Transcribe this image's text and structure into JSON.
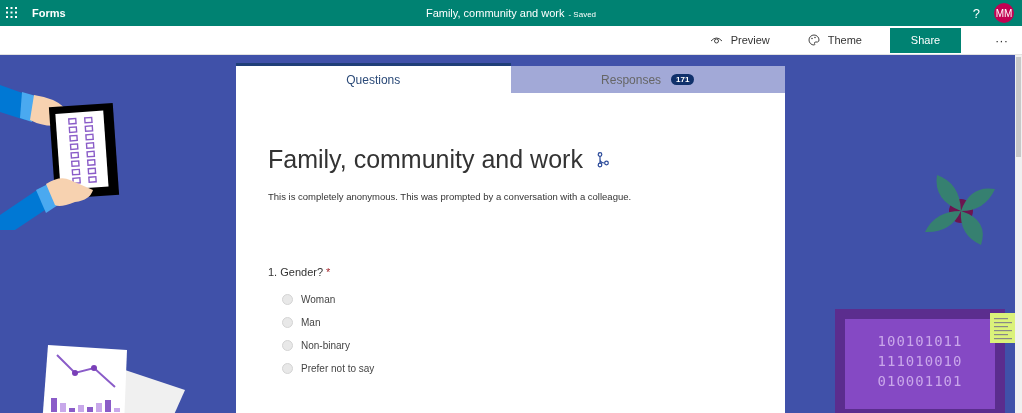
{
  "app": {
    "name": "Forms"
  },
  "document": {
    "title": "Family, community and work",
    "status": "- Saved"
  },
  "account": {
    "help": "?",
    "initials": "MM"
  },
  "commands": [
    {
      "kind": "preview",
      "label": "Preview"
    },
    {
      "kind": "theme",
      "label": "Theme"
    },
    {
      "kind": "share",
      "label": "Share"
    },
    {
      "kind": "more",
      "label": "···"
    }
  ],
  "tabs": [
    {
      "label": "Questions",
      "selected": true
    },
    {
      "label": "Responses",
      "selected": false,
      "badge": "171"
    }
  ],
  "form": {
    "title": "Family, community and work",
    "description": "This is completely anonymous. This was prompted by a conversation with a colleague."
  },
  "questions": [
    {
      "number": "1.",
      "text": "Gender?",
      "required_mark": "*",
      "options": [
        {
          "label": "Woman",
          "selected": false
        },
        {
          "label": "Man",
          "selected": false
        },
        {
          "label": "Non-binary",
          "selected": false
        },
        {
          "label": "Prefer not to say",
          "selected": false
        }
      ]
    }
  ],
  "decoration": {
    "binary_lines": [
      "100101011",
      "111010010",
      "010001101"
    ]
  }
}
